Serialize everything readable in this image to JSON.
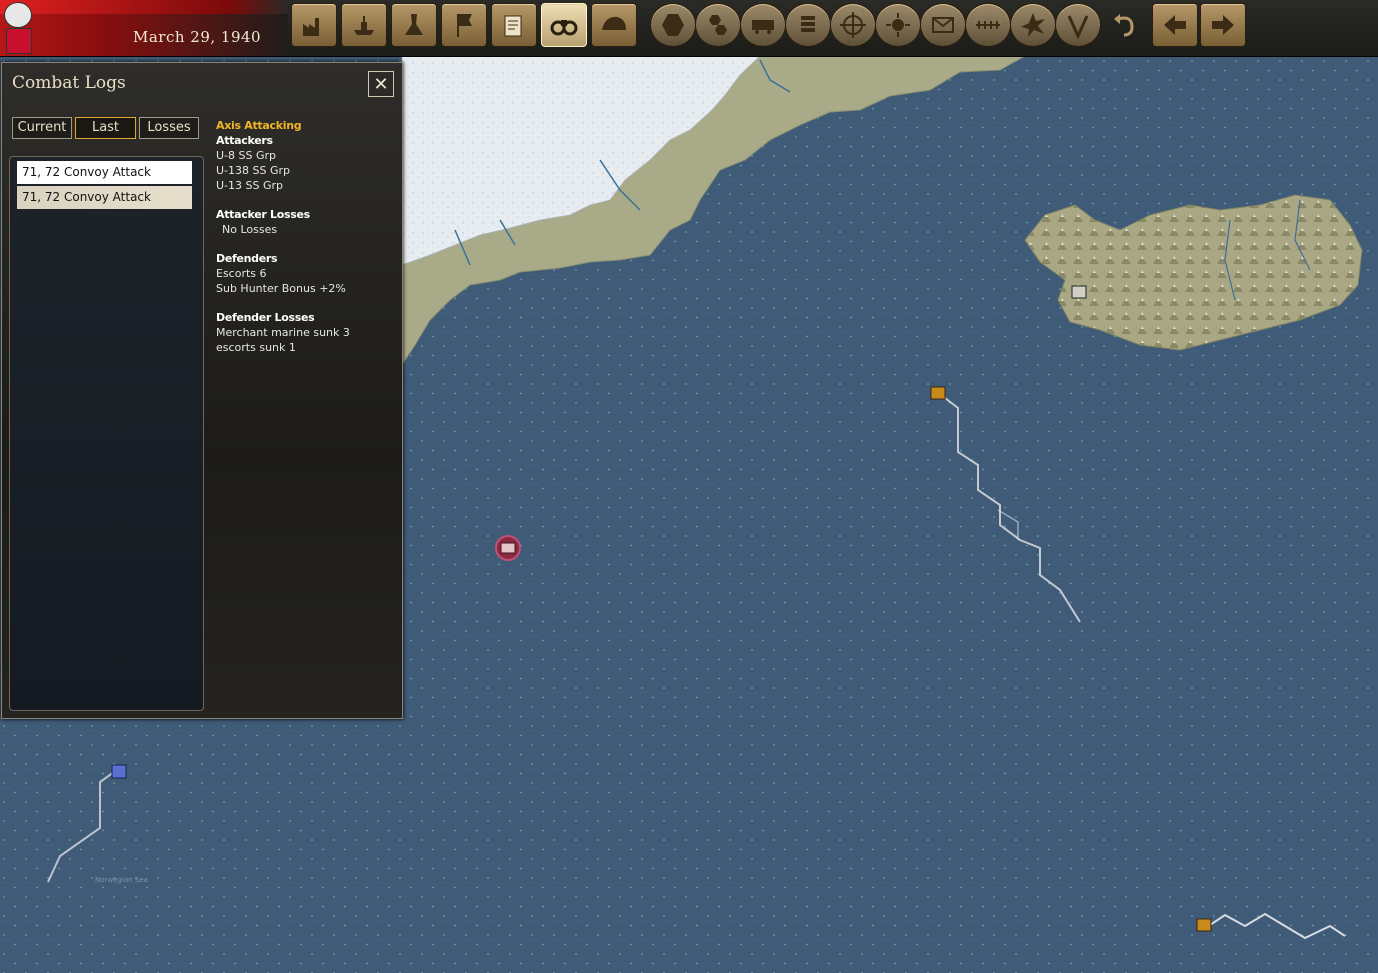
{
  "top_bar": {
    "date": "March 29, 1940",
    "buttons": [
      {
        "name": "production-icon",
        "active": false
      },
      {
        "name": "naval-icon",
        "active": false
      },
      {
        "name": "research-icon",
        "active": false
      },
      {
        "name": "diplomacy-flag-icon",
        "active": false
      },
      {
        "name": "reports-icon",
        "active": false
      },
      {
        "name": "binoculars-icon",
        "active": true
      },
      {
        "name": "helmet-icon",
        "active": false
      },
      {
        "name": "hex-icon",
        "active": false
      },
      {
        "name": "multi-hex-icon",
        "active": false
      },
      {
        "name": "train-icon",
        "active": false
      },
      {
        "name": "coins-icon",
        "active": false
      },
      {
        "name": "crosshair-icon",
        "active": false
      },
      {
        "name": "sun-icon",
        "active": false
      },
      {
        "name": "envelope-icon",
        "active": false
      },
      {
        "name": "defensive-line-icon",
        "active": false
      },
      {
        "name": "explosion-icon",
        "active": false
      },
      {
        "name": "victory-icon",
        "active": false
      },
      {
        "name": "undo-icon",
        "active": false
      },
      {
        "name": "previous-arrow-icon",
        "active": false
      },
      {
        "name": "next-arrow-icon",
        "active": false
      }
    ]
  },
  "panel": {
    "title": "Combat Logs",
    "close_label": "✕",
    "tabs": [
      {
        "label": "Current",
        "active": false
      },
      {
        "label": "Last",
        "active": true
      },
      {
        "label": "Losses",
        "active": false
      }
    ],
    "log_entries": [
      {
        "label": "71, 72 Convoy Attack",
        "selected": true
      },
      {
        "label": "71, 72 Convoy Attack",
        "selected": false
      }
    ],
    "detail": {
      "attacking_side": "Axis Attacking",
      "attackers_header": "Attackers",
      "attackers": [
        "U-8 SS Grp",
        "U-138 SS Grp",
        "U-13 SS Grp"
      ],
      "attacker_losses_header": "Attacker Losses",
      "attacker_losses": "No Losses",
      "defenders_header": "Defenders",
      "defenders": [
        "Escorts 6",
        "Sub Hunter Bonus +2%"
      ],
      "defender_losses_header": "Defender Losses",
      "defender_losses": [
        "Merchant marine sunk 3",
        "escorts sunk 1"
      ]
    }
  },
  "map": {
    "sea_label": "Norwegian Sea",
    "colors": {
      "sea": "#3f5b78",
      "land": "#a8ab86",
      "snow": "#e4eaee",
      "convoy": "#c98a1c",
      "allied": "#5b6fd0"
    }
  }
}
